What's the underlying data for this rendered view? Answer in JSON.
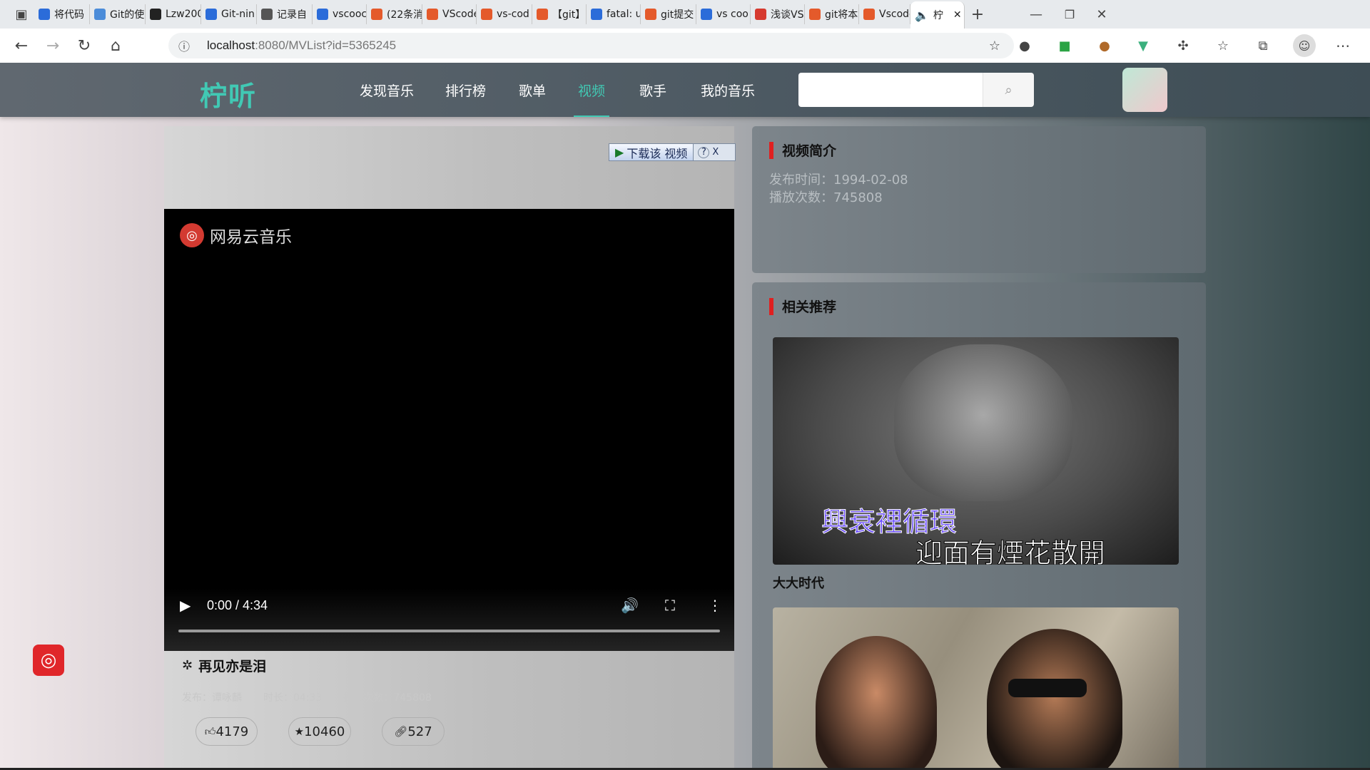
{
  "browser": {
    "tabs": [
      {
        "title": "将代码",
        "color": "#2b6cd9"
      },
      {
        "title": "Git的使",
        "color": "#4b8cd9"
      },
      {
        "title": "Lzw200",
        "color": "#222222"
      },
      {
        "title": "Git-nin",
        "color": "#2b6cd9"
      },
      {
        "title": "记录自",
        "color": "#555555"
      },
      {
        "title": "vscooc",
        "color": "#2b6cd9"
      },
      {
        "title": "(22条消",
        "color": "#e45a2b"
      },
      {
        "title": "VScode",
        "color": "#e45a2b"
      },
      {
        "title": "vs-cod",
        "color": "#e45a2b"
      },
      {
        "title": "【git】",
        "color": "#e45a2b"
      },
      {
        "title": "fatal: u",
        "color": "#2b6cd9"
      },
      {
        "title": "git提交",
        "color": "#e45a2b"
      },
      {
        "title": "vs coo",
        "color": "#2b6cd9"
      },
      {
        "title": "浅谈VS",
        "color": "#d63a2f"
      },
      {
        "title": "git将本",
        "color": "#e45a2b"
      },
      {
        "title": "Vscode",
        "color": "#e45a2b"
      }
    ],
    "active_tab": {
      "title": "柠"
    },
    "url": {
      "host": "localhost",
      "rest": ":8080/MVList?id=5365245"
    }
  },
  "app": {
    "logo": "柠听",
    "nav": [
      {
        "label": "发现音乐",
        "active": false
      },
      {
        "label": "排行榜",
        "active": false
      },
      {
        "label": "歌单",
        "active": false
      },
      {
        "label": "视频",
        "active": true
      },
      {
        "label": "歌手",
        "active": false
      },
      {
        "label": "我的音乐",
        "active": false
      }
    ],
    "search": {
      "placeholder": "",
      "value": ""
    },
    "accent": "#41c9b4"
  },
  "download_bar": {
    "label": "下载该 视频",
    "help": "?",
    "close": "X"
  },
  "video": {
    "watermark": "网易云音乐",
    "time": "0:00 / 4:34",
    "progress": 0
  },
  "mv": {
    "title": "再见亦是泪",
    "meta": {
      "publisher": "发布：谭咏麟",
      "duration": "时长：04:33",
      "plays": "播放次数：745808"
    },
    "likes": "4179",
    "collects": "10460",
    "shares": "527"
  },
  "intro": {
    "title": "视频简介",
    "publish_date_label": "发布时间：",
    "publish_date": "1994-02-08",
    "play_count_label": "播放次数：",
    "play_count": "745808"
  },
  "related": {
    "title": "相关推荐",
    "items": [
      {
        "title": "大大时代",
        "lyric_line1": "興衰裡循環",
        "lyric_line2": "迎面有煙花散開"
      },
      {
        "title": ""
      }
    ]
  }
}
